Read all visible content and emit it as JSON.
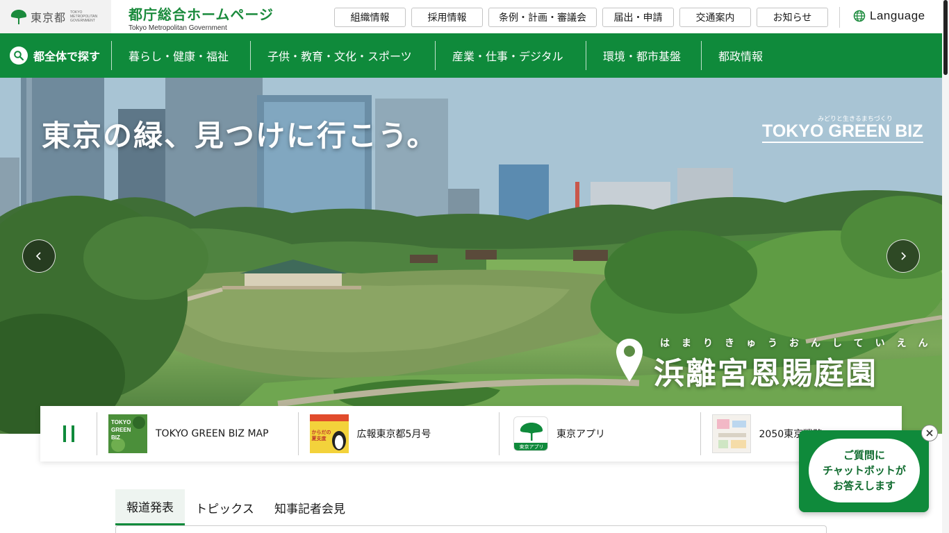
{
  "header": {
    "logo_name": "東京都",
    "logo_en": [
      "TOKYO",
      "METROPOLITAN",
      "GOVERNMENT"
    ],
    "site_title": "都庁総合ホームページ",
    "site_title_en": "Tokyo Metropolitan Government",
    "util_nav": [
      "組織情報",
      "採用情報",
      "条例・計画・審議会",
      "届出・申請",
      "交通案内",
      "お知らせ"
    ],
    "language_label": "Language"
  },
  "main_nav": {
    "search_label": "都全体で探す",
    "items": [
      "暮らし・健康・福祉",
      "子供・教育・文化・スポーツ",
      "産業・仕事・デジタル",
      "環境・都市基盤",
      "都政情報"
    ]
  },
  "hero": {
    "headline": "東京の緑、見つけに行こう。",
    "logo_ruby": "みどりと生きるまちづくり",
    "logo_brand": "TOKYO GREEN BIZ",
    "place_ruby": "はまりきゅうおんしていえん",
    "place_name": "浜離宮恩賜庭園"
  },
  "slides": [
    {
      "label": "TOKYO GREEN BIZ MAP",
      "thumb_text": "TOKYO GREEN BIZ"
    },
    {
      "label": "広報東京都5月号",
      "thumb_text": "からだの夏支度"
    },
    {
      "label": "東京アプリ",
      "thumb_text": "東京アプリ"
    },
    {
      "label": "2050東京戦略",
      "thumb_text": ""
    }
  ],
  "chatbot": {
    "lines": [
      "ご質問に",
      "チャットボットが",
      "お答えします"
    ]
  },
  "news_tabs": [
    "報道発表",
    "トピックス",
    "知事記者会見"
  ],
  "colors": {
    "brand_green": "#0f8a3b",
    "title_green": "#1a8a3c"
  }
}
